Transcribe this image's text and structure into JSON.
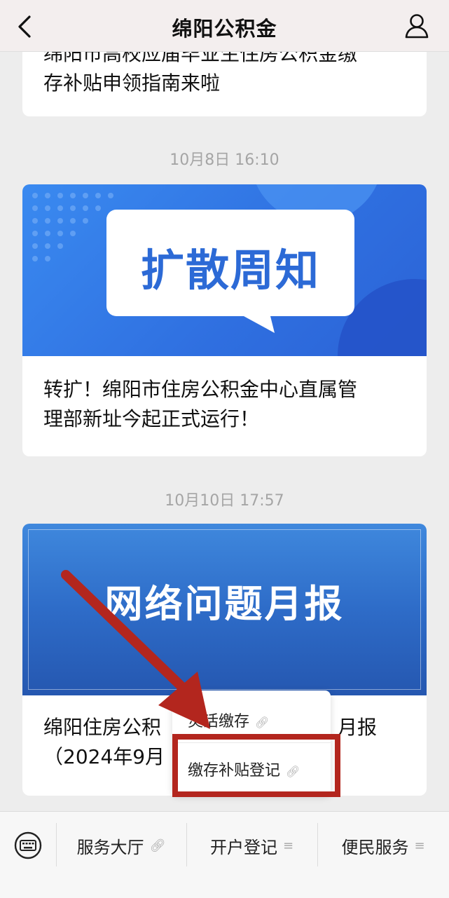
{
  "nav": {
    "title": "绵阳公积金",
    "back_icon": "back-arrow-icon",
    "user_icon": "user-icon"
  },
  "article1": {
    "title_line1": "绵阳市高校应届毕业生住房公积金缴",
    "title_line2": "存补贴申领指南来啦"
  },
  "timestamps": [
    "10月8日 16:10",
    "10月10日 17:57"
  ],
  "article2": {
    "banner_text": "扩散周知",
    "title_line1": "转扩！绵阳市住房公积金中心直属管",
    "title_line2": "理部新址今起正式运行！"
  },
  "article3": {
    "banner_text": "网络问题月报",
    "title_line1": "绵阳住房公积",
    "title_line1_tail": "月报",
    "title_line2": "（2024年9月"
  },
  "popup": {
    "items": [
      "灵活缴存",
      "缴存补贴登记"
    ]
  },
  "bottom_menu": {
    "keyboard_icon": "keyboard-icon",
    "items": [
      {
        "label": "服务大厅",
        "icon": "link-icon"
      },
      {
        "label": "开户登记",
        "icon": "menu-lines-icon"
      },
      {
        "label": "便民服务",
        "icon": "menu-lines-icon"
      }
    ]
  },
  "colors": {
    "annotation": "#b3261e",
    "banner_blue": "#2f6fe0"
  }
}
